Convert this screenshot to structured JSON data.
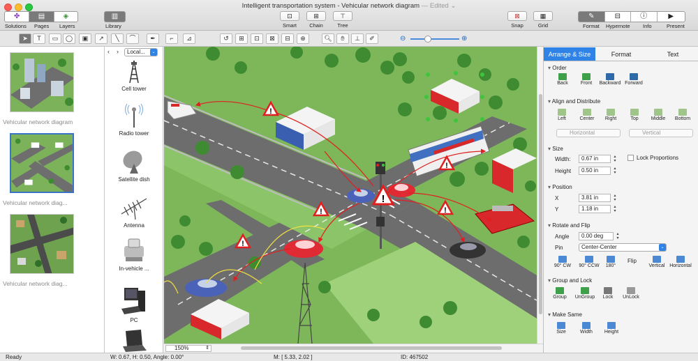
{
  "window": {
    "title": "Intelligent transportation system - Vehicular network diagram",
    "edited": "— Edited ⌄"
  },
  "toolbar": {
    "solutions": "Solutions",
    "pages": "Pages",
    "layers": "Layers",
    "library": "Library",
    "smart": "Smart",
    "chain": "Chain",
    "tree": "Tree",
    "snap": "Snap",
    "grid": "Grid",
    "format": "Format",
    "hypernote": "Hypernote",
    "info": "Info",
    "present": "Present"
  },
  "pages": [
    {
      "label": "Vehicular network diagram"
    },
    {
      "label": "Vehicular network diag..."
    },
    {
      "label": "Vehicular network diag..."
    }
  ],
  "library": {
    "location": "Local...",
    "items": [
      {
        "label": "Cell tower"
      },
      {
        "label": "Radio tower"
      },
      {
        "label": "Satellite dish"
      },
      {
        "label": "Antenna"
      },
      {
        "label": "In-vehicle ..."
      },
      {
        "label": "PC"
      }
    ]
  },
  "canvas": {
    "zoom": "150%"
  },
  "inspector": {
    "tabs": [
      "Arrange & Size",
      "Format",
      "Text"
    ],
    "order": {
      "title": "Order",
      "buttons": [
        "Back",
        "Front",
        "Backward",
        "Forward"
      ]
    },
    "align": {
      "title": "Align and Distribute",
      "buttons": [
        "Left",
        "Center",
        "Right",
        "Top",
        "Middle",
        "Bottom"
      ],
      "horizontal": "Horizontal",
      "vertical": "Vertical"
    },
    "size": {
      "title": "Size",
      "width_label": "Width:",
      "width": "0.67 in",
      "height_label": "Height",
      "height": "0.50 in",
      "lock": "Lock Proportions"
    },
    "position": {
      "title": "Position",
      "x_label": "X",
      "x": "3.81 in",
      "y_label": "Y",
      "y": "1.18 in"
    },
    "rotate": {
      "title": "Rotate and Flip",
      "angle_label": "Angle",
      "angle": "0.00 deg",
      "pin_label": "Pin",
      "pin": "Center-Center",
      "buttons": [
        "90° CW",
        "90° CCW",
        "180°"
      ],
      "flip": "Flip",
      "flip_buttons": [
        "Vertical",
        "Horizontal"
      ]
    },
    "group": {
      "title": "Group and Lock",
      "buttons": [
        "Group",
        "UnGroup",
        "Lock",
        "UnLock"
      ]
    },
    "same": {
      "title": "Make Same",
      "buttons": [
        "Size",
        "Width",
        "Height"
      ]
    }
  },
  "status": {
    "ready": "Ready",
    "dims": "W: 0.67,  H: 0.50,  Angle: 0.00°",
    "mouse": "M: [ 5.33, 2.02 ]",
    "id": "ID: 467502"
  },
  "colors": {
    "accent": "#2f83e6",
    "grass": "#7db75a",
    "road": "#6d6d6d"
  }
}
